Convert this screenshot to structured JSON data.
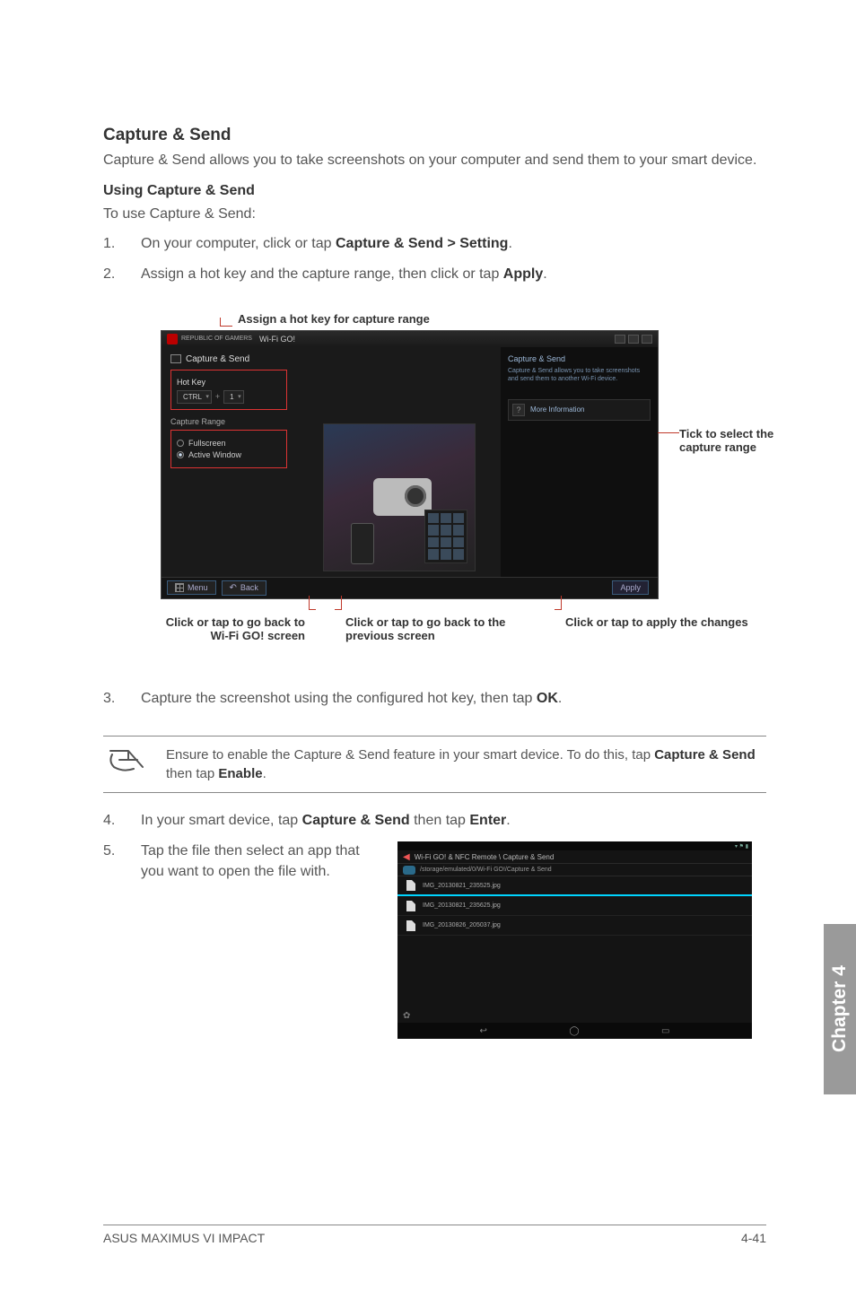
{
  "section": {
    "title": "Capture & Send",
    "intro": "Capture & Send allows you to take screenshots on your computer and send them to your smart device.",
    "subhead": "Using Capture & Send",
    "subintro": "To use Capture & Send:"
  },
  "steps": {
    "s1_num": "1.",
    "s1_a": "On your computer, click or tap ",
    "s1_b": "Capture & Send > Setting",
    "s1_c": ".",
    "s2_num": "2.",
    "s2_a": "Assign a hot key and the capture range, then click or tap ",
    "s2_b": "Apply",
    "s2_c": ".",
    "s3_num": "3.",
    "s3_a": "Capture the screenshot using the configured hot key, then tap ",
    "s3_b": "OK",
    "s3_c": ".",
    "s4_num": "4.",
    "s4_a": "In your smart device, tap ",
    "s4_b": "Capture & Send",
    "s4_c": " then tap ",
    "s4_d": "Enter",
    "s4_e": ".",
    "s5_num": "5.",
    "s5_a": "Tap the file then select an app that you want to open the file with."
  },
  "fig1": {
    "annot_top": "Assign a hot key for capture range",
    "annot_right": "Tick to select the capture range",
    "annot_bl": "Click or tap to go back to Wi-Fi GO! screen",
    "annot_bm": "Click or tap to go back to the previous screen",
    "annot_br": "Click or tap to apply the changes",
    "rog": "REPUBLIC OF GAMERS",
    "wintitle": "Wi-Fi GO!",
    "breadcrumb": "Capture & Send",
    "hotkey_label": "Hot Key",
    "hk_ctrl": "CTRL",
    "hk_plus": "+",
    "hk_num": "1",
    "cr_label": "Capture Range",
    "cr_opt1": "Fullscreen",
    "cr_opt2": "Active Window",
    "side_title": "Capture & Send",
    "side_text": "Capture & Send allows you to take screenshots and send them to another Wi-Fi device.",
    "side_more": "More Information",
    "side_q": "?",
    "ft_menu": "Menu",
    "ft_back": "Back",
    "ft_apply": "Apply"
  },
  "note": {
    "a": "Ensure to enable the Capture & Send feature in your smart device. To do this, tap ",
    "b": "Capture & Send",
    "c": " then tap ",
    "d": "Enable",
    "e": "."
  },
  "mobile": {
    "statusbar_icons": "▾ ⚑ ▮",
    "path_title": "Wi-Fi GO! & NFC Remote \\ Capture & Send",
    "subpath": "/storage/emulated/0/Wi-Fi GO!/Capture & Send",
    "file1": "IMG_20130821_235525.jpg",
    "file2": "IMG_20130821_235625.jpg",
    "file3": "IMG_20130826_205037.jpg",
    "nav_back": "↩",
    "nav_home": "◯",
    "nav_recent": "▭",
    "gear": "✿"
  },
  "chapter": "Chapter 4",
  "footer": {
    "left": "ASUS MAXIMUS VI IMPACT",
    "right": "4-41"
  }
}
